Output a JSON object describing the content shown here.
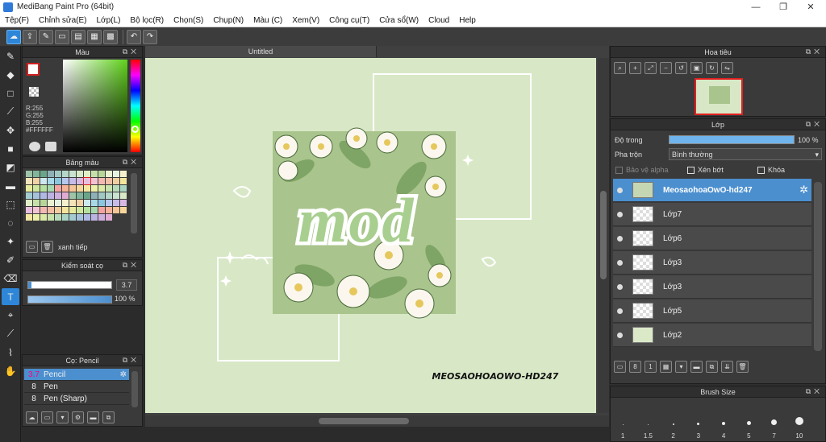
{
  "app": {
    "title": "MediBang Paint Pro (64bit)"
  },
  "menu": [
    "Tệp(F)",
    "Chỉnh sửa(E)",
    "Lớp(L)",
    "Bộ lọc(R)",
    "Chọn(S)",
    "Chụp(N)",
    "Màu (C)",
    "Xem(V)",
    "Công cụ(T)",
    "Cửa sổ(W)",
    "Cloud",
    "Help"
  ],
  "window_controls": {
    "min": "—",
    "max": "❐",
    "close": "✕"
  },
  "color_panel": {
    "title": "Màu",
    "r": "R:255",
    "g": "G:255",
    "b": "B:255",
    "hex": "#FFFFFF"
  },
  "palette_panel": {
    "title": "Bảng màu",
    "name": "xanh tiếp"
  },
  "brush_ctrl": {
    "title": "Kiểm soát cọ",
    "size": "3.7",
    "opacity": "100 %"
  },
  "brush_panel": {
    "title": "Cọ: Pencil",
    "items": [
      {
        "size": "3.7",
        "name": "Pencil"
      },
      {
        "size": "8",
        "name": "Pen"
      },
      {
        "size": "8",
        "name": "Pen (Sharp)"
      }
    ]
  },
  "canvas": {
    "tab": "Untitled",
    "signature": "MEOSAOHOAOWO-HD247",
    "word": "mod"
  },
  "navigator": {
    "title": "Hoa tiêu"
  },
  "layers": {
    "title": "Lớp",
    "opacity_label": "Độ trong",
    "opacity_value": "100 %",
    "blend_label": "Pha trộn",
    "blend_value": "Bình thường",
    "protect_alpha": "Bảo vệ alpha",
    "clip": "Xén bớt",
    "lock": "Khóa",
    "items": [
      {
        "name": "MeosaohoaOwO-hd247"
      },
      {
        "name": "Lớp7"
      },
      {
        "name": "Lớp6"
      },
      {
        "name": "Lớp3"
      },
      {
        "name": "Lớp3"
      },
      {
        "name": "Lớp5"
      },
      {
        "name": "Lớp2"
      }
    ]
  },
  "brush_size": {
    "title": "Brush Size",
    "sizes": [
      "1",
      "1.5",
      "2",
      "3",
      "4",
      "5",
      "7",
      "10"
    ]
  }
}
